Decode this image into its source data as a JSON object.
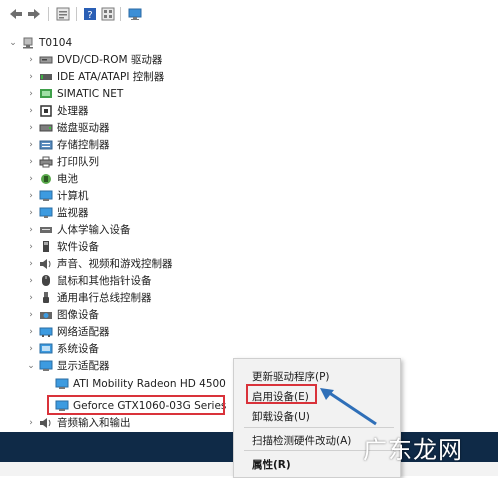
{
  "toolbar": {
    "buttons": [
      "back-icon",
      "forward-icon",
      "properties-icon",
      "help-icon",
      "view-icon",
      "monitor-icon"
    ]
  },
  "tree": {
    "root": "T0104",
    "categories": [
      "DVD/CD-ROM 驱动器",
      "IDE ATA/ATAPI 控制器",
      "SIMATIC NET",
      "处理器",
      "磁盘驱动器",
      "存储控制器",
      "打印队列",
      "电池",
      "计算机",
      "监视器",
      "人体学输入设备",
      "软件设备",
      "声音、视频和游戏控制器",
      "鼠标和其他指针设备",
      "通用串行总线控制器",
      "图像设备",
      "网络适配器",
      "系统设备",
      "显示适配器"
    ],
    "display_children": [
      "ATI Mobility Radeon HD 4500",
      "Geforce GTX1060-03G Series"
    ],
    "after": "音频输入和输出"
  },
  "context_menu": {
    "items": [
      "更新驱动程序(P)",
      "启用设备(E)",
      "卸载设备(U)",
      "扫描检测硬件改动(A)",
      "属性(R)"
    ]
  },
  "watermark": "广东龙网",
  "colors": {
    "highlight": "#d9323a",
    "arrow": "#2f6fb8",
    "bottom_bar": "#0f2a47"
  }
}
